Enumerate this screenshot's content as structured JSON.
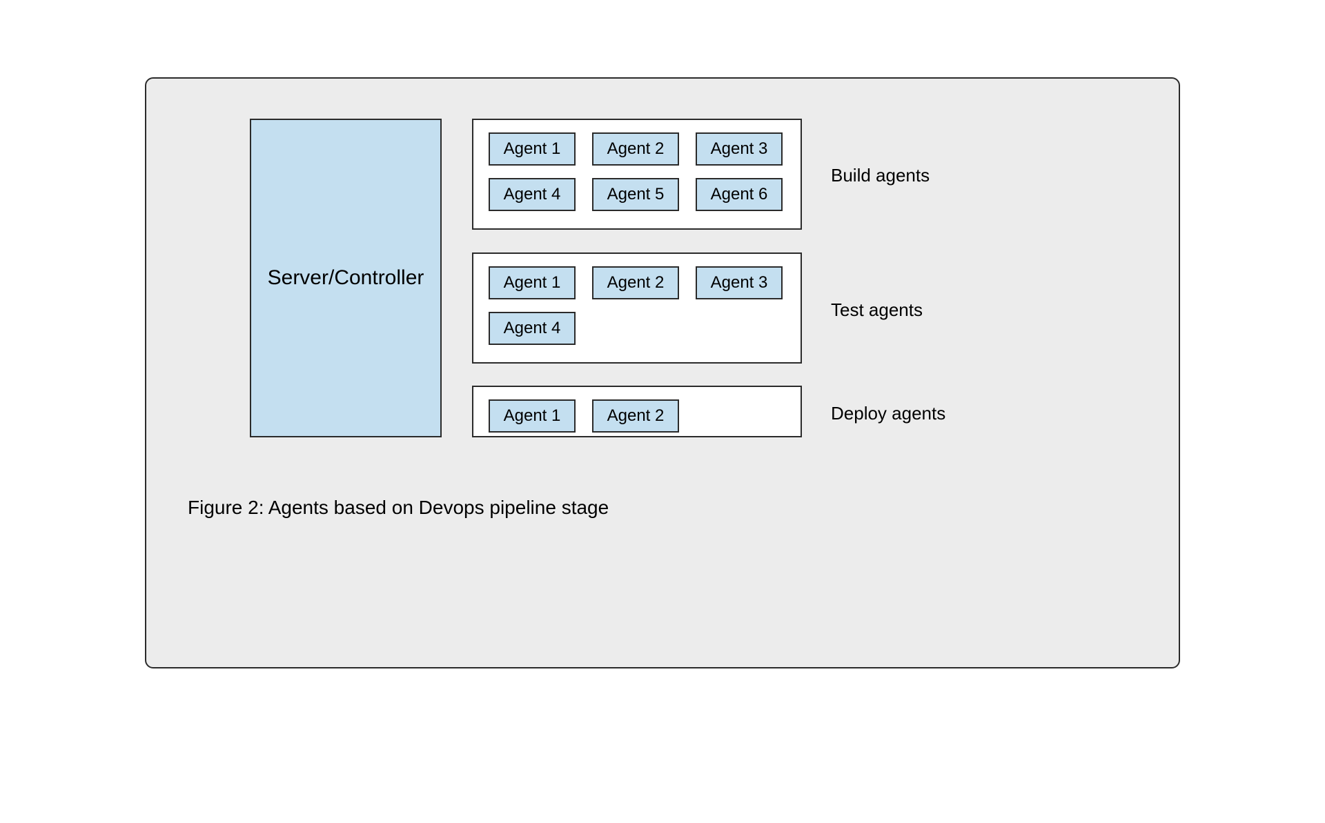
{
  "server_label": "Server/Controller",
  "groups": {
    "build": {
      "label": "Build agents",
      "agents": [
        "Agent 1",
        "Agent 2",
        "Agent 3",
        "Agent 4",
        "Agent 5",
        "Agent 6"
      ]
    },
    "test": {
      "label": "Test agents",
      "agents": [
        "Agent 1",
        "Agent 2",
        "Agent 3",
        "Agent 4"
      ]
    },
    "deploy": {
      "label": "Deploy agents",
      "agents": [
        "Agent 1",
        "Agent 2"
      ]
    }
  },
  "caption": "Figure 2: Agents based on Devops pipeline stage",
  "colors": {
    "canvas_bg": "#ececec",
    "box_fill": "#c4dff0",
    "border": "#2a2a2a",
    "group_bg": "#ffffff"
  }
}
